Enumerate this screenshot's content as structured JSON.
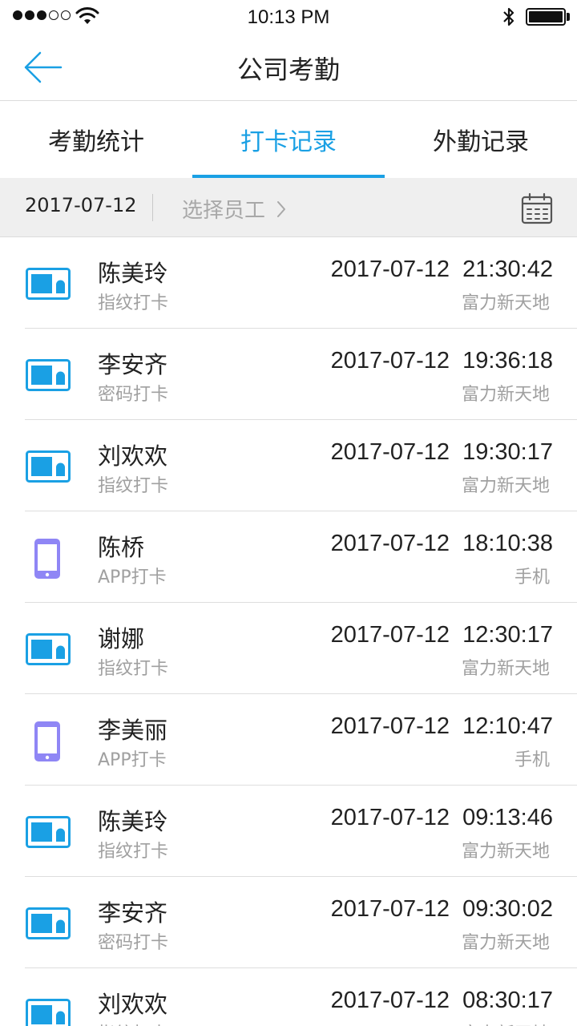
{
  "status_bar": {
    "time": "10:13 PM"
  },
  "nav": {
    "title": "公司考勤"
  },
  "tabs": [
    {
      "label": "考勤统计",
      "active": false
    },
    {
      "label": "打卡记录",
      "active": true
    },
    {
      "label": "外勤记录",
      "active": false
    }
  ],
  "filter": {
    "date": "2017-07-12",
    "employee_label": "选择员工"
  },
  "colors": {
    "accent": "#1aa0e4",
    "phone_icon": "#8f86f5",
    "card_icon": "#1aa0e4"
  },
  "records": [
    {
      "name": "陈美玲",
      "method": "指纹打卡",
      "datetime": "2017-07-12  21:30:42",
      "location": "富力新天地",
      "icon": "card-reader-icon"
    },
    {
      "name": "李安齐",
      "method": "密码打卡",
      "datetime": "2017-07-12  19:36:18",
      "location": "富力新天地",
      "icon": "card-reader-icon"
    },
    {
      "name": "刘欢欢",
      "method": "指纹打卡",
      "datetime": "2017-07-12  19:30:17",
      "location": "富力新天地",
      "icon": "card-reader-icon"
    },
    {
      "name": "陈桥",
      "method": "APP打卡",
      "datetime": "2017-07-12  18:10:38",
      "location": "手机",
      "icon": "phone-icon"
    },
    {
      "name": "谢娜",
      "method": "指纹打卡",
      "datetime": "2017-07-12  12:30:17",
      "location": "富力新天地",
      "icon": "card-reader-icon"
    },
    {
      "name": "李美丽",
      "method": "APP打卡",
      "datetime": "2017-07-12  12:10:47",
      "location": "手机",
      "icon": "phone-icon"
    },
    {
      "name": "陈美玲",
      "method": "指纹打卡",
      "datetime": "2017-07-12  09:13:46",
      "location": "富力新天地",
      "icon": "card-reader-icon"
    },
    {
      "name": "李安齐",
      "method": "密码打卡",
      "datetime": "2017-07-12  09:30:02",
      "location": "富力新天地",
      "icon": "card-reader-icon"
    },
    {
      "name": "刘欢欢",
      "method": "指纹打卡",
      "datetime": "2017-07-12  08:30:17",
      "location": "富力新天地",
      "icon": "card-reader-icon"
    }
  ]
}
